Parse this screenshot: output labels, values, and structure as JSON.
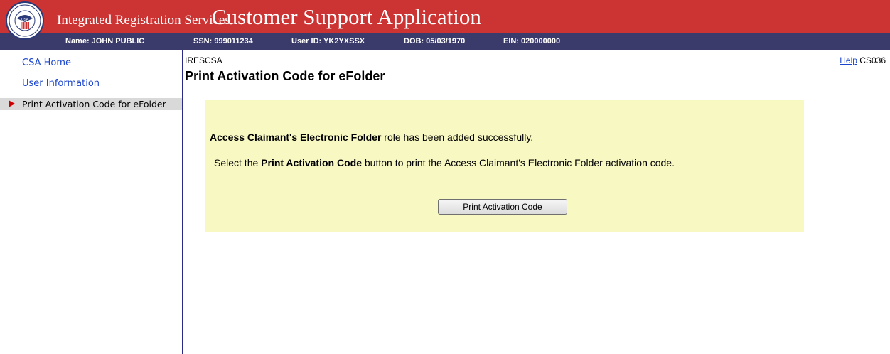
{
  "header": {
    "brand": "Integrated Registration Services",
    "app_title": "Customer Support Application",
    "logo": {
      "name": "ssa-seal-icon",
      "text": "SOCIAL SECURITY ADMINISTRATION USA"
    }
  },
  "infobar": {
    "name": "Name: JOHN PUBLIC",
    "ssn": "SSN: 999011234",
    "user_id": "User ID: YK2YXSSX",
    "dob": "DOB: 05/03/1970",
    "ein": "EIN: 020000000"
  },
  "sidebar": {
    "items": [
      {
        "label": "CSA Home",
        "active": false
      },
      {
        "label": "User Information",
        "active": false
      },
      {
        "label": "Print Activation Code for eFolder",
        "active": true
      }
    ]
  },
  "main": {
    "screen_id": "IRESCSA",
    "title": "Print Activation Code for eFolder",
    "help_label": "Help",
    "screen_code": "CS036",
    "message": {
      "bold_role": "Access Claimant's Electronic Folder",
      "role_text": " role has been added successfully.",
      "select_prefix": "Select the ",
      "select_bold": "Print Activation Code",
      "select_suffix": " button to print the Access Claimant's Electronic Folder activation code."
    },
    "print_button_label": "Print Activation Code"
  },
  "colors": {
    "banner": "#cc3333",
    "infobar": "#3b3b6b",
    "panel": "#f8f8c2",
    "link": "#1a44cc",
    "nav_arrow": "#cc0000"
  }
}
